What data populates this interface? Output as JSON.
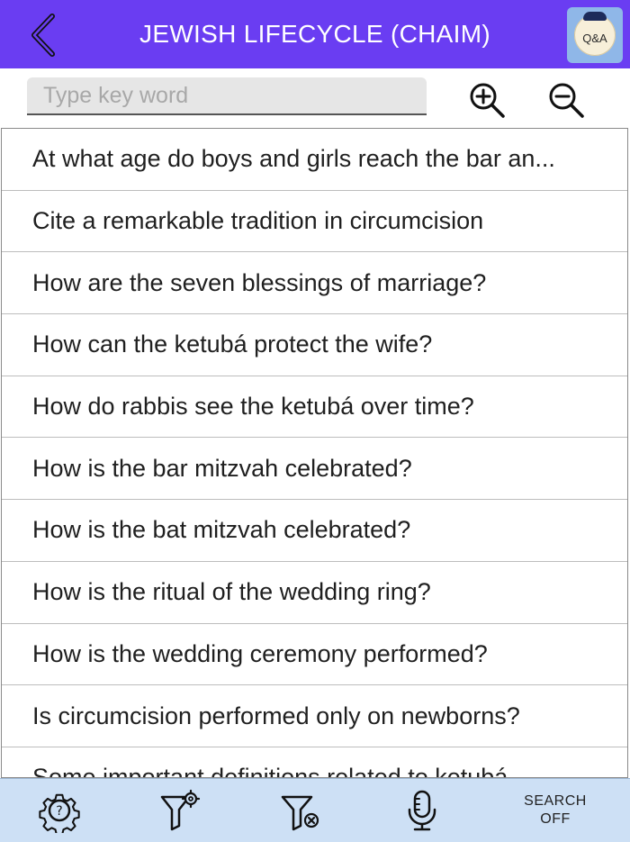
{
  "header": {
    "title": "JEWISH LIFECYCLE (CHAIM)",
    "back_icon": "chevron-left-icon",
    "qa_badge": "Q&A"
  },
  "search": {
    "placeholder": "Type key word",
    "value": ""
  },
  "list": {
    "items": [
      "At what age do boys and girls reach the bar an...",
      "Cite a remarkable tradition in circumcision",
      "How are the seven blessings of marriage?",
      "How can the ketubá protect the wife?",
      "How do rabbis see the ketubá over time?",
      "How is the bar mitzvah celebrated?",
      "How is the bat mitzvah celebrated?",
      "How is the ritual of the wedding ring?",
      "How is the wedding ceremony performed?",
      "Is circumcision performed only on newborns?",
      "Some important definitions related to ketubá"
    ]
  },
  "toolbar": {
    "icons": [
      "gear-question-icon",
      "filter-settings-icon",
      "filter-clear-icon",
      "microphone-icon"
    ],
    "search_toggle_line1": "SEARCH",
    "search_toggle_line2": "OFF"
  },
  "colors": {
    "header_bg": "#6a3df2",
    "toolbar_bg": "#cde0f5",
    "qa_bg": "#8fb7e8"
  }
}
